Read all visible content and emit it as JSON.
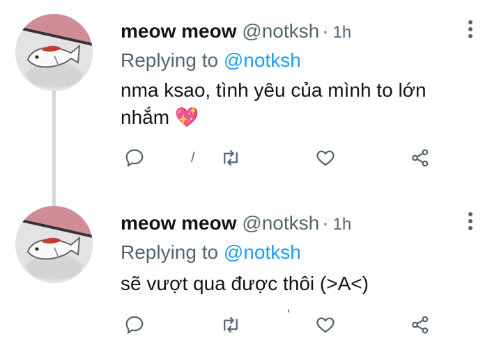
{
  "tweets": [
    {
      "name": "meow meow",
      "handle": "@notksh",
      "separator": "·",
      "time": "1h",
      "replying_prefix": "Replying to ",
      "replying_handle": "@notksh",
      "text_line1": "nma ksao, tình yêu của mình to lớn",
      "text_line2": "nhắm 💖",
      "retweet_count": "/"
    },
    {
      "name": "meow meow",
      "handle": "@notksh",
      "separator": "·",
      "time": "1h",
      "replying_prefix": "Replying to ",
      "replying_handle": "@notksh",
      "text_line1": "sẽ vượt qua được thôi (>A<)",
      "text_line2": "",
      "like_count": "'"
    }
  ],
  "icons": {
    "reply": "reply-icon",
    "retweet": "retweet-icon",
    "like": "heart-icon",
    "share": "share-icon",
    "more": "more-options-icon"
  },
  "colors": {
    "text": "#0f1419",
    "secondary": "#536471",
    "accent": "#1d9bf0",
    "thread_line": "#cfd9de"
  }
}
